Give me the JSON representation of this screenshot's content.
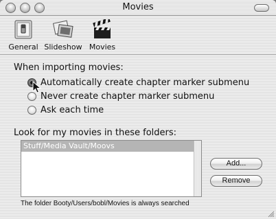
{
  "window": {
    "title": "Movies"
  },
  "toolbar": {
    "items": [
      {
        "label": "General",
        "icon": "switch-icon"
      },
      {
        "label": "Slideshow",
        "icon": "slideshow-icon"
      },
      {
        "label": "Movies",
        "icon": "clapperboard-icon"
      }
    ]
  },
  "import_section": {
    "heading": "When importing movies:",
    "options": [
      {
        "label": "Automatically create chapter marker submenu",
        "selected": true
      },
      {
        "label": "Never create chapter marker submenu",
        "selected": false
      },
      {
        "label": "Ask each time",
        "selected": false
      }
    ]
  },
  "folders_section": {
    "heading": "Look for my movies in these folders:",
    "folders": [
      "Stuff/Media Vault/Moovs"
    ],
    "add_label": "Add...",
    "remove_label": "Remove",
    "note": "The folder Booty/Users/bobl/Movies is always searched"
  }
}
